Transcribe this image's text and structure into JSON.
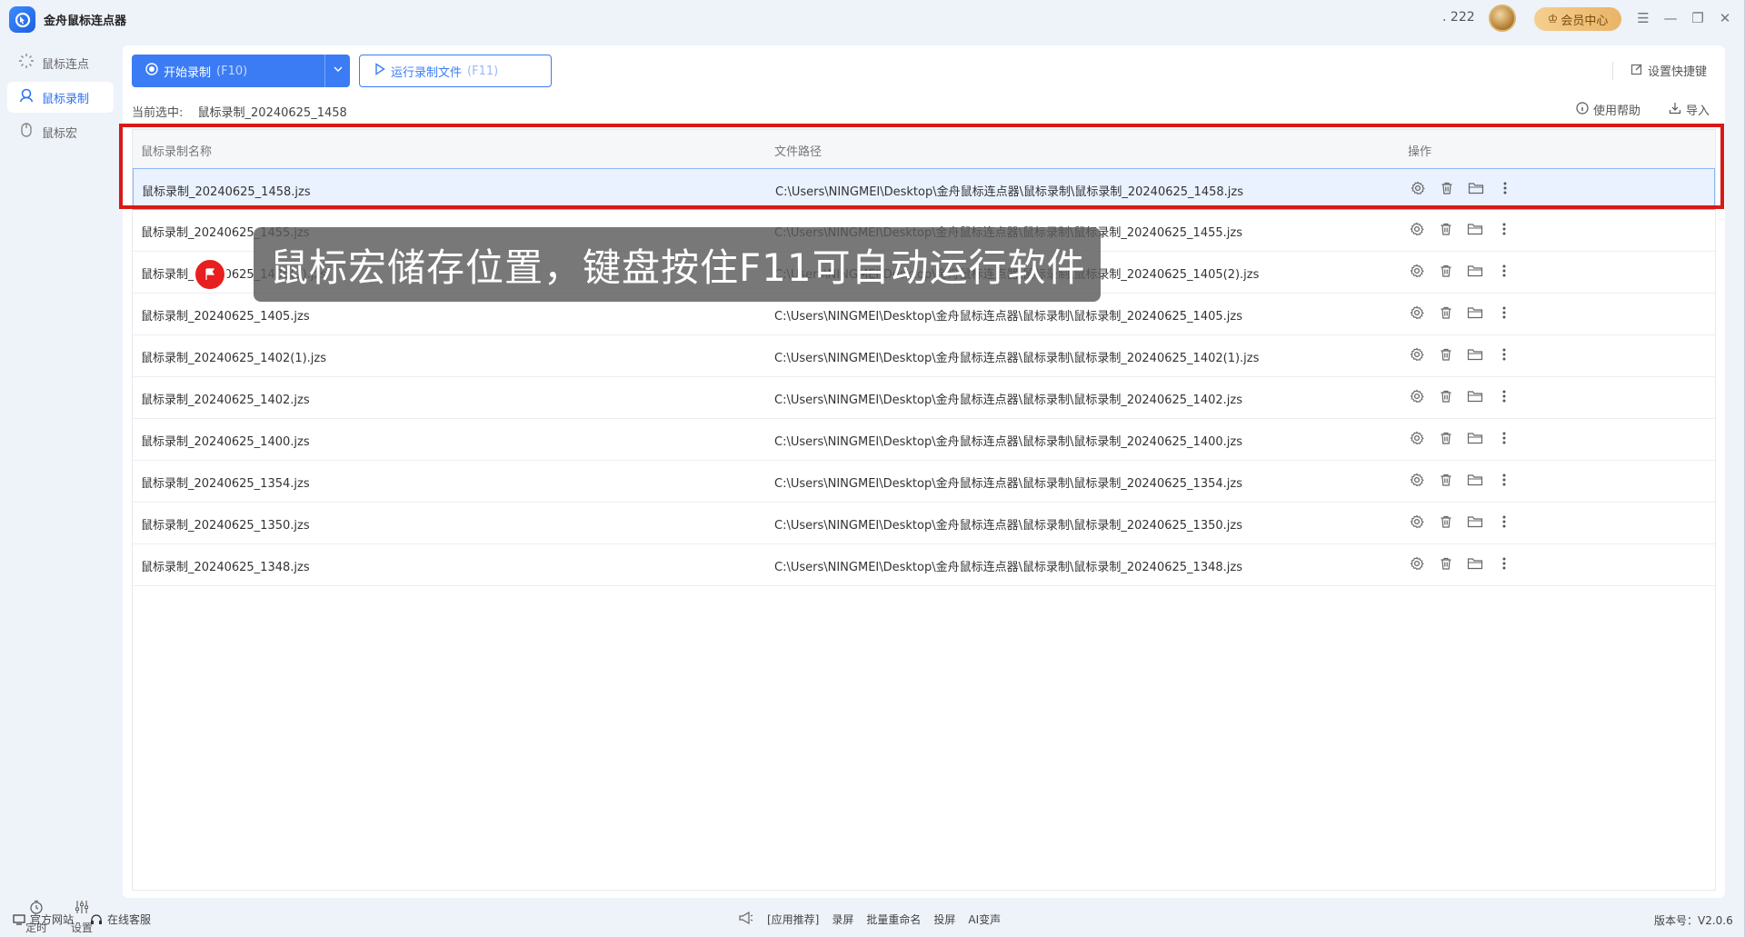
{
  "app": {
    "title": "金舟鼠标连点器"
  },
  "header": {
    "coins": "222",
    "vip_label": "会员中心"
  },
  "sidebar": {
    "items": [
      {
        "label": "鼠标连点"
      },
      {
        "label": "鼠标录制"
      },
      {
        "label": "鼠标宏"
      }
    ],
    "bottom": [
      {
        "label": "定时"
      },
      {
        "label": "设置"
      }
    ]
  },
  "toolbar": {
    "start_label": "开始录制",
    "start_hotkey": "(F10)",
    "run_label": "运行录制文件",
    "run_hotkey": "(F11)",
    "shortcut_label": "设置快捷键",
    "help_label": "使用帮助",
    "import_label": "导入"
  },
  "current": {
    "label": "当前选中:",
    "value": "鼠标录制_20240625_1458"
  },
  "table": {
    "headers": {
      "name": "鼠标录制名称",
      "path": "文件路径",
      "ops": "操作"
    },
    "rows": [
      {
        "name": "鼠标录制_20240625_1458.jzs",
        "path": "C:\\Users\\NINGMEI\\Desktop\\金舟鼠标连点器\\鼠标录制\\鼠标录制_20240625_1458.jzs"
      },
      {
        "name": "鼠标录制_20240625_1455.jzs",
        "path": "C:\\Users\\NINGMEI\\Desktop\\金舟鼠标连点器\\鼠标录制\\鼠标录制_20240625_1455.jzs"
      },
      {
        "name": "鼠标录制_20240625_1405(2).jzs",
        "path": "C:\\Users\\NINGMEI\\Desktop\\金舟鼠标连点器\\鼠标录制\\鼠标录制_20240625_1405(2).jzs"
      },
      {
        "name": "鼠标录制_20240625_1405.jzs",
        "path": "C:\\Users\\NINGMEI\\Desktop\\金舟鼠标连点器\\鼠标录制\\鼠标录制_20240625_1405.jzs"
      },
      {
        "name": "鼠标录制_20240625_1402(1).jzs",
        "path": "C:\\Users\\NINGMEI\\Desktop\\金舟鼠标连点器\\鼠标录制\\鼠标录制_20240625_1402(1).jzs"
      },
      {
        "name": "鼠标录制_20240625_1402.jzs",
        "path": "C:\\Users\\NINGMEI\\Desktop\\金舟鼠标连点器\\鼠标录制\\鼠标录制_20240625_1402.jzs"
      },
      {
        "name": "鼠标录制_20240625_1400.jzs",
        "path": "C:\\Users\\NINGMEI\\Desktop\\金舟鼠标连点器\\鼠标录制\\鼠标录制_20240625_1400.jzs"
      },
      {
        "name": "鼠标录制_20240625_1354.jzs",
        "path": "C:\\Users\\NINGMEI\\Desktop\\金舟鼠标连点器\\鼠标录制\\鼠标录制_20240625_1354.jzs"
      },
      {
        "name": "鼠标录制_20240625_1350.jzs",
        "path": "C:\\Users\\NINGMEI\\Desktop\\金舟鼠标连点器\\鼠标录制\\鼠标录制_20240625_1350.jzs"
      },
      {
        "name": "鼠标录制_20240625_1348.jzs",
        "path": "C:\\Users\\NINGMEI\\Desktop\\金舟鼠标连点器\\鼠标录制\\鼠标录制_20240625_1348.jzs"
      }
    ]
  },
  "overlay": {
    "caption": "鼠标宏储存位置，键盘按住F11可自动运行软件"
  },
  "footer": {
    "website": "官方网站",
    "support": "在线客服",
    "recommend": "[应用推荐]",
    "apps": [
      "录屏",
      "批量重命名",
      "投屏",
      "AI变声"
    ],
    "version": "版本号：V2.0.6"
  },
  "colors": {
    "accent": "#3b7cf4",
    "highlight": "#d81919",
    "vip": "#e9b467"
  }
}
